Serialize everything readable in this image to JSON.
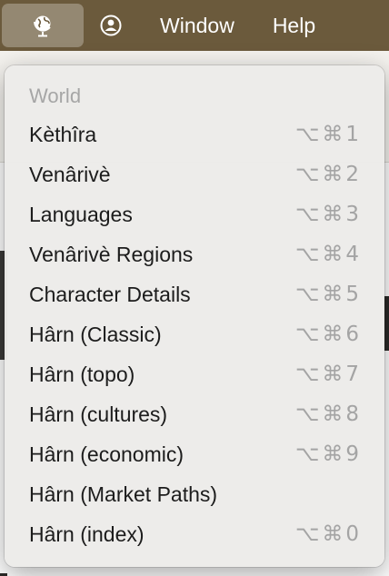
{
  "menubar": {
    "globe_icon": "globe-icon",
    "person_icon": "person-icon",
    "window_label": "Window",
    "help_label": "Help",
    "bar_color": "#6b5a3c"
  },
  "menu": {
    "header": "World",
    "items": [
      {
        "label": "Kèthîra",
        "shortcut": "⌥⌘1"
      },
      {
        "label": "Venârivè",
        "shortcut": "⌥⌘2"
      },
      {
        "label": "Languages",
        "shortcut": "⌥⌘3"
      },
      {
        "label": "Venârivè Regions",
        "shortcut": "⌥⌘4"
      },
      {
        "label": "Character Details",
        "shortcut": "⌥⌘5"
      },
      {
        "label": "Hârn (Classic)",
        "shortcut": "⌥⌘6"
      },
      {
        "label": "Hârn (topo)",
        "shortcut": "⌥⌘7"
      },
      {
        "label": "Hârn (cultures)",
        "shortcut": "⌥⌘8"
      },
      {
        "label": "Hârn (economic)",
        "shortcut": "⌥⌘9"
      },
      {
        "label": "Hârn (Market Paths)",
        "shortcut": ""
      },
      {
        "label": "Hârn (index)",
        "shortcut": "⌥⌘0"
      }
    ]
  }
}
